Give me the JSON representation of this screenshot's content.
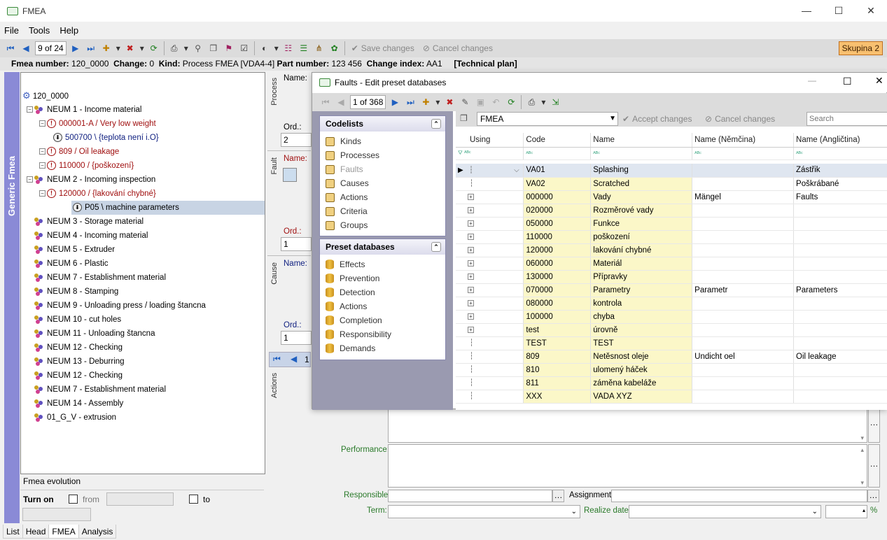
{
  "window": {
    "title": "FMEA",
    "min": "—",
    "max": "☐",
    "close": "✕"
  },
  "menu": [
    "File",
    "Tools",
    "Help"
  ],
  "toolbar": {
    "nav_pos": "9 of 24",
    "save": "Save changes",
    "cancel": "Cancel changes",
    "group": "Skupina 2"
  },
  "info": {
    "fmea_label": "Fmea number:",
    "fmea": "120_0000",
    "change_label": "Change:",
    "change": "0",
    "kind_label": "Kind:",
    "kind": "Process FMEA [VDA4-4]",
    "part_label": "Part number:",
    "part": "123 456",
    "idx_label": "Change index:",
    "idx": "AA1",
    "plan": "[Technical plan]"
  },
  "rail": "Generic Fmea",
  "tree": {
    "root": "120_0000",
    "items": [
      "NEUM 1 - Income material",
      "000001-A / Very low weight",
      "500700 \\ {teplota není i.O}",
      "809 / Oil leakage",
      "110000 / {poškození}",
      "NEUM 2 - Incoming inspection",
      "120000 / {lakování chybné}",
      "P05 \\ machine parameters",
      "NEUM 3 - Storage material",
      "NEUM 4 - Incoming material",
      "NEUM 5 - Extruder",
      "NEUM 6 - Plastic",
      "NEUM 7 - Establishment material",
      "NEUM 8 - Stamping",
      "NEUM 9 - Unloading press / loading štancna",
      "NEUM 10 - cut holes",
      "NEUM 11 - Unloading štancna",
      "NEUM 12 - Checking",
      "NEUM 13 - Deburring",
      "NEUM 12 - Checking",
      "NEUM 7 - Establishment material",
      "NEUM 14 - Assembly",
      "01_G_V - extrusion"
    ]
  },
  "evolution": {
    "title": "Fmea evolution",
    "turn_on": "Turn on",
    "from": "from",
    "to": "to"
  },
  "tabs": [
    "List",
    "Head",
    "FMEA",
    "Analysis"
  ],
  "mid": {
    "process": "Process",
    "fault": "Fault",
    "cause": "Cause",
    "actions": "Actions",
    "name": "Name:",
    "ord": "Ord.:",
    "ord1": "2",
    "ord2": "1",
    "ord3": "1",
    "nav1": "1",
    "performance": "Performance:",
    "responsible": "Responsible:",
    "assignment": "Assignment:",
    "term": "Term:",
    "realize": "Realize date:",
    "pct": "%"
  },
  "dialog": {
    "title": "Faults - Edit preset databases",
    "nav_pos": "1 of 368",
    "codelists_title": "Codelists",
    "codelists": [
      "Kinds",
      "Processes",
      "Faults",
      "Causes",
      "Actions",
      "Criteria",
      "Groups"
    ],
    "preset_title": "Preset databases",
    "preset": [
      "Effects",
      "Prevention",
      "Detection",
      "Actions",
      "Completion",
      "Responsibility",
      "Demands"
    ],
    "grid_source": "FMEA",
    "accept": "Accept changes",
    "cancel": "Cancel changes",
    "search_placeholder": "Search",
    "columns": [
      "Using",
      "Code",
      "Name",
      "Name (Němčina)",
      "Name (Angličtina)"
    ],
    "rows": [
      [
        "VA01",
        "Splashing",
        "",
        "Zástřik"
      ],
      [
        "VA02",
        "Scratched",
        "",
        "Poškrábané"
      ],
      [
        "000000",
        "Vady",
        "Mängel",
        "Faults"
      ],
      [
        "020000",
        "Rozměrové vady",
        "",
        ""
      ],
      [
        "050000",
        "Funkce",
        "",
        ""
      ],
      [
        "110000",
        "poškození",
        "",
        ""
      ],
      [
        "120000",
        "lakování chybné",
        "",
        ""
      ],
      [
        "060000",
        "Materiál",
        "",
        ""
      ],
      [
        "130000",
        "Přípravky",
        "",
        ""
      ],
      [
        "070000",
        "Parametry",
        "Parametr",
        "Parameters"
      ],
      [
        "080000",
        "kontrola",
        "",
        ""
      ],
      [
        "100000",
        "chyba",
        "",
        ""
      ],
      [
        "test",
        "úrovně",
        "",
        ""
      ],
      [
        "TEST",
        "TEST",
        "",
        ""
      ],
      [
        "809",
        "Netěsnost oleje",
        "Undicht oel",
        "Oil leakage"
      ],
      [
        "810",
        "ulomený háček",
        "",
        ""
      ],
      [
        "811",
        "záměna kabeláže",
        "",
        ""
      ],
      [
        "XXX",
        "VADA XYZ",
        "",
        ""
      ]
    ]
  }
}
